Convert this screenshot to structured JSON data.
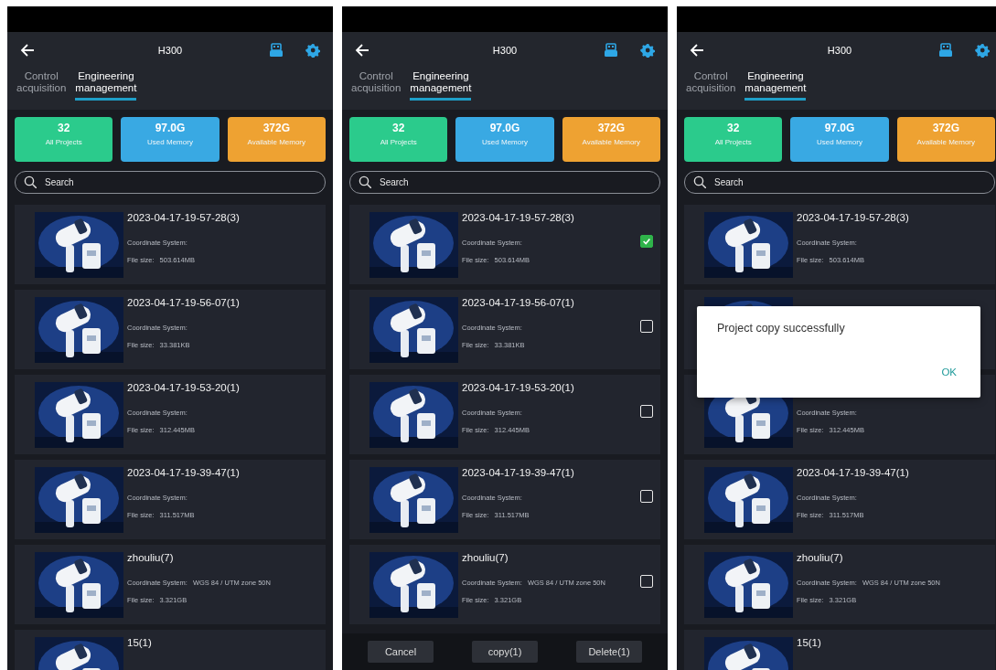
{
  "panels": [
    {
      "header": {
        "title": "H300"
      },
      "tabs": [
        {
          "label": "Control acquisition",
          "selected": false
        },
        {
          "label": "Engineering management",
          "selected": true
        }
      ],
      "stats": [
        {
          "value": "32",
          "label": "All Projects",
          "color": "#2bcb8c"
        },
        {
          "value": "97.0G",
          "label": "Used Memory",
          "color": "#39a9e3"
        },
        {
          "value": "372G",
          "label": "Available Memory",
          "color": "#eea232"
        }
      ],
      "search": {
        "placeholder": "Search"
      },
      "projects": [
        {
          "kind": "project",
          "title": "2023-04-17-19-57-28(3)",
          "coordinate_label": "Coordinate System:",
          "file_size_label": "File size:",
          "file_size": "503.614MB"
        },
        {
          "kind": "project",
          "title": "2023-04-17-19-56-07(1)",
          "coordinate_label": "Coordinate System:",
          "file_size_label": "File size:",
          "file_size": "33.381KB"
        },
        {
          "kind": "project",
          "title": "2023-04-17-19-53-20(1)",
          "coordinate_label": "Coordinate System:",
          "file_size_label": "File size:",
          "file_size": "312.445MB"
        },
        {
          "kind": "project",
          "title": "2023-04-17-19-39-47(1)",
          "coordinate_label": "Coordinate System:",
          "file_size_label": "File size:",
          "file_size": "311.517MB"
        },
        {
          "kind": "project",
          "title": "zhouliu(7)",
          "coordinate_label": "Coordinate System:",
          "coordinate_value": "WGS 84 / UTM zone 50N",
          "file_size_label": "File size:",
          "file_size": "3.321GB"
        },
        {
          "kind": "project",
          "title": "15(1)"
        }
      ]
    },
    {
      "header": {
        "title": "H300"
      },
      "tabs": [
        {
          "label": "Control acquisition",
          "selected": false
        },
        {
          "label": "Engineering management",
          "selected": true
        }
      ],
      "stats": [
        {
          "value": "32",
          "label": "All Projects",
          "color": "#2bcb8c"
        },
        {
          "value": "97.0G",
          "label": "Used Memory",
          "color": "#39a9e3"
        },
        {
          "value": "372G",
          "label": "Available Memory",
          "color": "#eea232"
        }
      ],
      "search": {
        "placeholder": "Search"
      },
      "projects": [
        {
          "kind": "project",
          "title": "2023-04-17-19-57-28(3)",
          "coordinate_label": "Coordinate System:",
          "file_size_label": "File size:",
          "file_size": "503.614MB",
          "checked": true
        },
        {
          "kind": "project",
          "title": "2023-04-17-19-56-07(1)",
          "coordinate_label": "Coordinate System:",
          "file_size_label": "File size:",
          "file_size": "33.381KB",
          "checked": false
        },
        {
          "kind": "project",
          "title": "2023-04-17-19-53-20(1)",
          "coordinate_label": "Coordinate System:",
          "file_size_label": "File size:",
          "file_size": "312.445MB",
          "checked": false
        },
        {
          "kind": "project",
          "title": "2023-04-17-19-39-47(1)",
          "coordinate_label": "Coordinate System:",
          "file_size_label": "File size:",
          "file_size": "311.517MB",
          "checked": false
        },
        {
          "kind": "project",
          "title": "zhouliu(7)",
          "coordinate_label": "Coordinate System:",
          "coordinate_value": "WGS 84 / UTM zone 50N",
          "file_size_label": "File size:",
          "file_size": "3.321GB",
          "checked": false
        }
      ],
      "action_bar": [
        "Cancel",
        "copy(1)",
        "Delete(1)"
      ]
    },
    {
      "header": {
        "title": "H300"
      },
      "tabs": [
        {
          "label": "Control acquisition",
          "selected": false
        },
        {
          "label": "Engineering management",
          "selected": true
        }
      ],
      "stats": [
        {
          "value": "32",
          "label": "All Projects",
          "color": "#2bcb8c"
        },
        {
          "value": "97.0G",
          "label": "Used Memory",
          "color": "#39a9e3"
        },
        {
          "value": "372G",
          "label": "Available Memory",
          "color": "#eea232"
        }
      ],
      "search": {
        "placeholder": "Search"
      },
      "projects": [
        {
          "kind": "project",
          "title": "2023-04-17-19-57-28(3)",
          "coordinate_label": "Coordinate System:",
          "file_size_label": "File size:",
          "file_size": "503.614MB"
        },
        {
          "kind": "picture"
        },
        {
          "kind": "project",
          "coordinate_label": "Coordinate System:",
          "file_size_label": "File size:",
          "file_size": "312.445MB"
        },
        {
          "kind": "project",
          "title": "2023-04-17-19-39-47(1)",
          "coordinate_label": "Coordinate System:",
          "file_size_label": "File size:",
          "file_size": "311.517MB"
        },
        {
          "kind": "project",
          "title": "zhouliu(7)",
          "coordinate_label": "Coordinate System:",
          "coordinate_value": "WGS 84 / UTM zone 50N",
          "file_size_label": "File size:",
          "file_size": "3.321GB"
        },
        {
          "kind": "project",
          "title": "15(1)"
        }
      ],
      "dialog": {
        "message": "Project copy successfully",
        "button": "OK"
      }
    }
  ]
}
